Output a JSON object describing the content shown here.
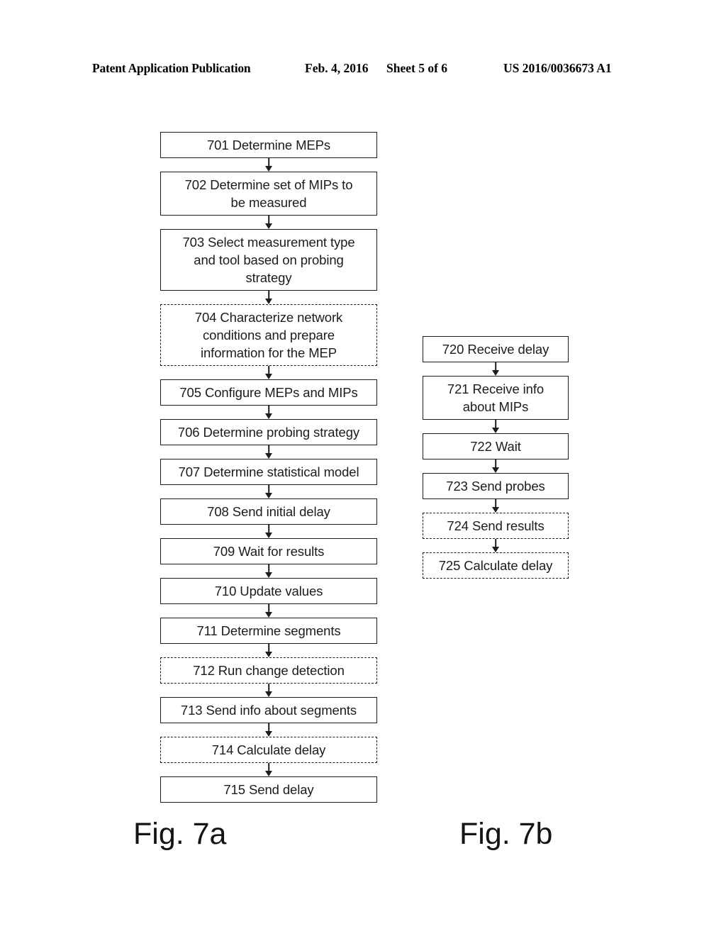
{
  "header": {
    "publication": "Patent Application Publication",
    "date": "Feb. 4, 2016",
    "sheet": "Sheet 5 of 6",
    "patent_number": "US 2016/0036673 A1"
  },
  "figures": [
    {
      "id": "7a",
      "caption": "Fig. 7a",
      "nodes": [
        {
          "id": "701",
          "text": "701 Determine MEPs",
          "style": "solid",
          "lines": 1
        },
        {
          "id": "702",
          "text": "702 Determine set of MIPs to\nbe measured",
          "style": "solid",
          "lines": 2
        },
        {
          "id": "703",
          "text": "703 Select measurement type\nand tool based on probing\nstrategy",
          "style": "solid",
          "lines": 3
        },
        {
          "id": "704",
          "text": "704 Characterize network\nconditions and prepare\ninformation for the MEP",
          "style": "dashed",
          "lines": 3
        },
        {
          "id": "705",
          "text": "705 Configure MEPs and MIPs",
          "style": "solid",
          "lines": 1
        },
        {
          "id": "706",
          "text": "706 Determine probing strategy",
          "style": "solid",
          "lines": 1
        },
        {
          "id": "707",
          "text": "707 Determine statistical model",
          "style": "solid",
          "lines": 1
        },
        {
          "id": "708",
          "text": "708 Send initial delay",
          "style": "solid",
          "lines": 1
        },
        {
          "id": "709",
          "text": "709 Wait for results",
          "style": "solid",
          "lines": 1
        },
        {
          "id": "710",
          "text": "710 Update values",
          "style": "solid",
          "lines": 1
        },
        {
          "id": "711",
          "text": "711 Determine segments",
          "style": "solid",
          "lines": 1
        },
        {
          "id": "712",
          "text": "712 Run change detection",
          "style": "dashed",
          "lines": 1
        },
        {
          "id": "713",
          "text": "713 Send info about segments",
          "style": "solid",
          "lines": 1
        },
        {
          "id": "714",
          "text": "714 Calculate delay",
          "style": "dashed",
          "lines": 1
        },
        {
          "id": "715",
          "text": "715 Send delay",
          "style": "solid",
          "lines": 1
        }
      ]
    },
    {
      "id": "7b",
      "caption": "Fig. 7b",
      "nodes": [
        {
          "id": "720",
          "text": "720 Receive delay",
          "style": "solid",
          "lines": 1
        },
        {
          "id": "721",
          "text": "721  Receive info\nabout MIPs",
          "style": "solid",
          "lines": 2
        },
        {
          "id": "722",
          "text": "722 Wait",
          "style": "solid",
          "lines": 1
        },
        {
          "id": "723",
          "text": "723 Send probes",
          "style": "solid",
          "lines": 1
        },
        {
          "id": "724",
          "text": "724 Send results",
          "style": "dashed",
          "lines": 1
        },
        {
          "id": "725",
          "text": "725 Calculate delay",
          "style": "dashed",
          "lines": 1
        }
      ]
    }
  ],
  "colors": {
    "ink": "#1c1c1c",
    "page_background": "#ffffff"
  }
}
